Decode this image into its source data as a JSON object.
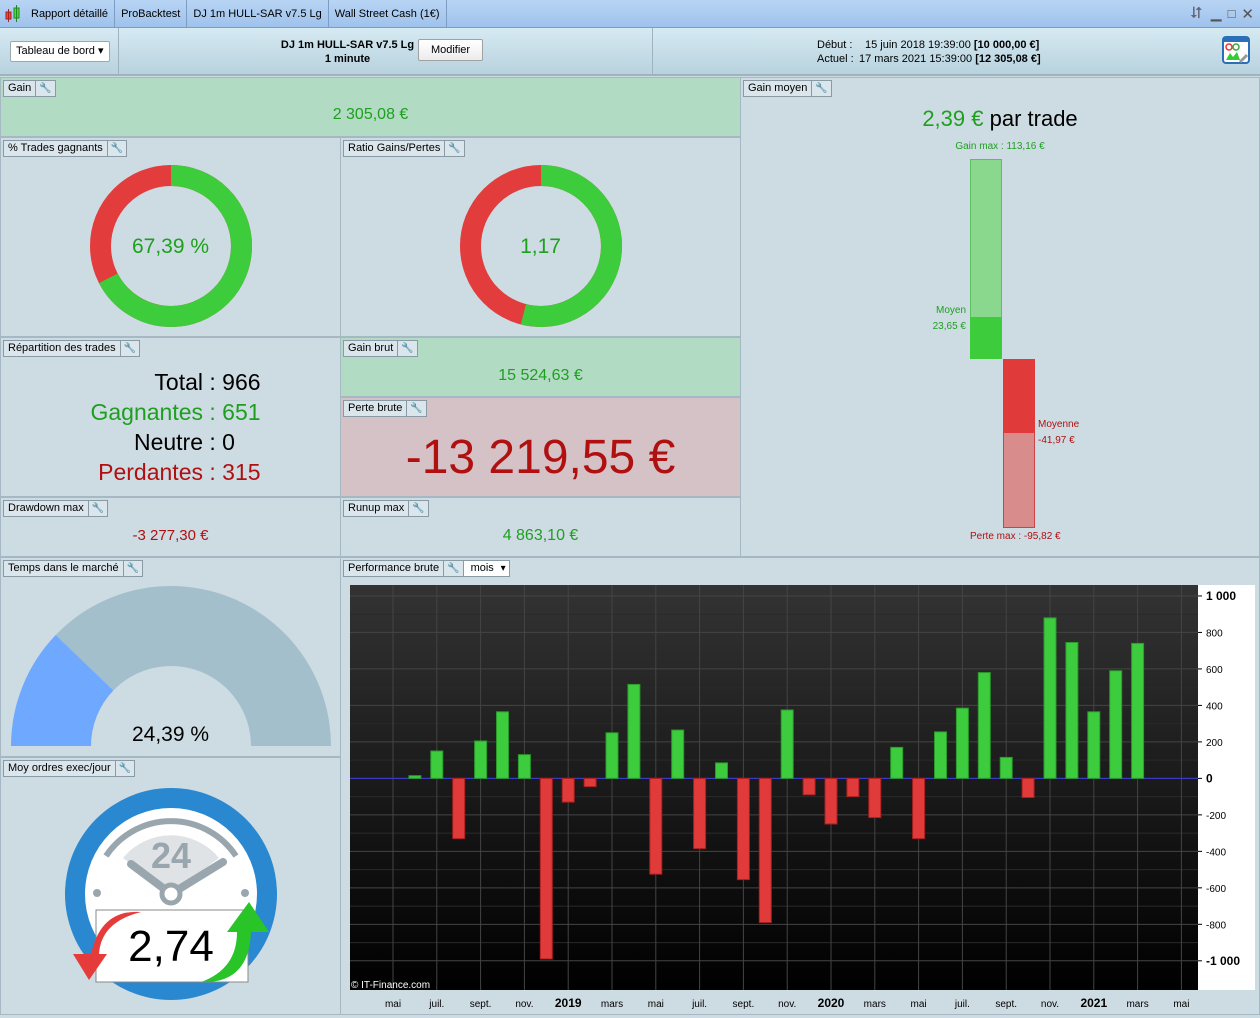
{
  "titlebar": {
    "tabs": [
      "Rapport détaillé",
      "ProBacktest",
      "DJ 1m HULL-SAR v7.5 Lg",
      "Wall Street Cash (1€)"
    ]
  },
  "header": {
    "view_select": "Tableau de bord",
    "system_name": "DJ 1m HULL-SAR v7.5 Lg",
    "timeframe": "1 minute",
    "modify_label": "Modifier",
    "start_label": "Début :",
    "start_date": "15 juin 2018 19:39:00",
    "start_capital": "[10 000,00 €]",
    "current_label": "Actuel :",
    "current_date": "17 mars 2021 15:39:00",
    "current_capital": "[12 305,08 €]"
  },
  "gain": {
    "title": "Gain",
    "value": "2 305,08 €"
  },
  "win_pct": {
    "title": "% Trades gagnants",
    "value": "67,39 %",
    "fraction": 0.6739
  },
  "ratio": {
    "title": "Ratio Gains/Pertes",
    "value": "1,17",
    "green_fraction": 0.54
  },
  "avg_gain": {
    "title": "Gain moyen",
    "value": "2,39 €",
    "suffix": "par trade",
    "max_gain_label": "Gain max : 113,16 €",
    "avg_win_label": "Moyen",
    "avg_win_value": "23,65 €",
    "avg_loss_label": "Moyenne",
    "avg_loss_value": "-41,97 €",
    "max_loss_label": "Perte max : -95,82 €",
    "max_gain": 113.16,
    "avg_win": 23.65,
    "avg_loss": -41.97,
    "max_loss": -95.82
  },
  "distribution": {
    "title": "Répartition des trades",
    "rows": [
      {
        "label": "Total",
        "value": "966"
      },
      {
        "label": "Gagnantes",
        "value": "651"
      },
      {
        "label": "Neutre",
        "value": "0"
      },
      {
        "label": "Perdantes",
        "value": "315"
      }
    ]
  },
  "gross_gain": {
    "title": "Gain brut",
    "value": "15 524,63 €"
  },
  "gross_loss": {
    "title": "Perte brute",
    "value": "-13 219,55 €"
  },
  "drawdown": {
    "title": "Drawdown max",
    "value": "-3 277,30 €"
  },
  "runup": {
    "title": "Runup max",
    "value": "4 863,10 €"
  },
  "time_in_market": {
    "title": "Temps dans le marché",
    "value": "24,39 %",
    "fraction": 0.2439
  },
  "orders": {
    "title": "Moy ordres exec/jour",
    "value": "2,74",
    "clock_label": "24"
  },
  "performance": {
    "title": "Performance brute",
    "period_select": "mois",
    "copyright": "© IT-Finance.com"
  },
  "colors": {
    "positive": "#3dcc3d",
    "negative": "#e03a3a",
    "gain_bg": "#b1dbc3",
    "loss_bg": "#d5c2c6",
    "gauge_fill": "#6fa8ff",
    "gauge_rest": "#a3bfcc"
  },
  "chart_data": {
    "type": "bar",
    "grid": true,
    "categories": [
      "juin 2018",
      "juil. 2018",
      "août 2018",
      "sept. 2018",
      "oct. 2018",
      "nov. 2018",
      "déc. 2018",
      "janv. 2019",
      "févr. 2019",
      "mars 2019",
      "avr. 2019",
      "mai 2019",
      "juin 2019",
      "juil. 2019",
      "août 2019",
      "sept. 2019",
      "oct. 2019",
      "nov. 2019",
      "déc. 2019",
      "janv. 2020",
      "févr. 2020",
      "mars 2020",
      "avr. 2020",
      "mai 2020",
      "juin 2020",
      "juil. 2020",
      "août 2020",
      "sept. 2020",
      "oct. 2020",
      "nov. 2020",
      "déc. 2020",
      "janv. 2021",
      "févr. 2021",
      "mars 2021"
    ],
    "values": [
      15,
      150,
      -330,
      205,
      365,
      130,
      -990,
      -130,
      -45,
      250,
      515,
      -525,
      265,
      -385,
      85,
      -555,
      -790,
      375,
      -90,
      -250,
      -100,
      -215,
      170,
      -330,
      255,
      385,
      580,
      115,
      -105,
      880,
      745,
      365,
      590,
      740
    ],
    "x_tick_labels": [
      "mai",
      "juil.",
      "sept.",
      "nov.",
      "2019",
      "mars",
      "mai",
      "juil.",
      "sept.",
      "nov.",
      "2020",
      "mars",
      "mai",
      "juil.",
      "sept.",
      "nov.",
      "2021",
      "mars",
      "mai"
    ],
    "y_tick_labels": [
      "1 000",
      "800",
      "600",
      "400",
      "200",
      "0",
      "-200",
      "-400",
      "-600",
      "-800",
      "-1 000"
    ],
    "y_ticks": [
      1000,
      800,
      600,
      400,
      200,
      0,
      -200,
      -400,
      -600,
      -800,
      -1000
    ],
    "ylim": [
      -1160,
      1060
    ]
  }
}
